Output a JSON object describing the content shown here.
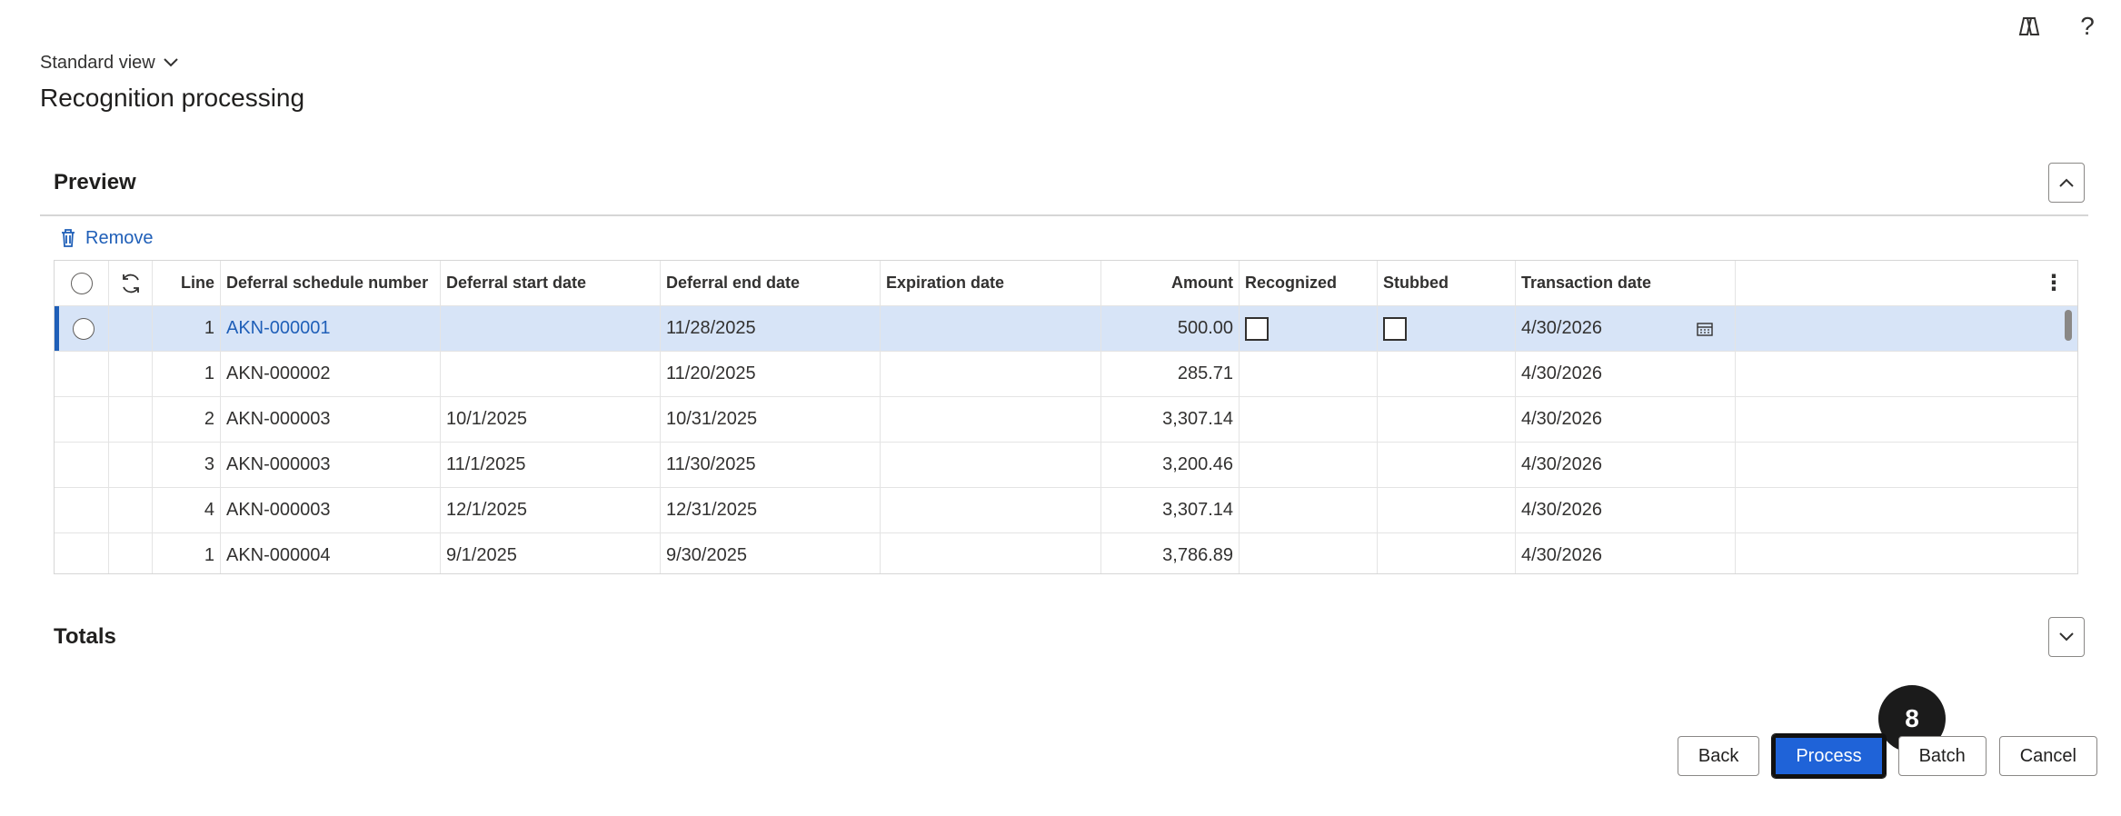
{
  "header": {
    "view_label": "Standard view",
    "page_title": "Recognition processing"
  },
  "preview": {
    "title": "Preview",
    "remove_label": "Remove",
    "columns": {
      "line": "Line",
      "schedule": "Deferral schedule number",
      "start": "Deferral start date",
      "end": "Deferral end date",
      "expiration": "Expiration date",
      "amount": "Amount",
      "recognized": "Recognized",
      "stubbed": "Stubbed",
      "transaction": "Transaction date"
    },
    "rows": [
      {
        "line": "1",
        "schedule": "AKN-000001",
        "start": "",
        "end": "11/28/2025",
        "expiration": "",
        "amount": "500.00",
        "transaction": "4/30/2026"
      },
      {
        "line": "1",
        "schedule": "AKN-000002",
        "start": "",
        "end": "11/20/2025",
        "expiration": "",
        "amount": "285.71",
        "transaction": "4/30/2026"
      },
      {
        "line": "2",
        "schedule": "AKN-000003",
        "start": "10/1/2025",
        "end": "10/31/2025",
        "expiration": "",
        "amount": "3,307.14",
        "transaction": "4/30/2026"
      },
      {
        "line": "3",
        "schedule": "AKN-000003",
        "start": "11/1/2025",
        "end": "11/30/2025",
        "expiration": "",
        "amount": "3,200.46",
        "transaction": "4/30/2026"
      },
      {
        "line": "4",
        "schedule": "AKN-000003",
        "start": "12/1/2025",
        "end": "12/31/2025",
        "expiration": "",
        "amount": "3,307.14",
        "transaction": "4/30/2026"
      },
      {
        "line": "1",
        "schedule": "AKN-000004",
        "start": "9/1/2025",
        "end": "9/30/2025",
        "expiration": "",
        "amount": "3,786.89",
        "transaction": "4/30/2026"
      }
    ]
  },
  "totals": {
    "title": "Totals"
  },
  "footer": {
    "back": "Back",
    "process": "Process",
    "batch": "Batch",
    "cancel": "Cancel",
    "step_badge": "8"
  },
  "colors": {
    "accent": "#1f63d8",
    "link": "#1f5fb8",
    "selected_row": "#d7e4f7"
  }
}
